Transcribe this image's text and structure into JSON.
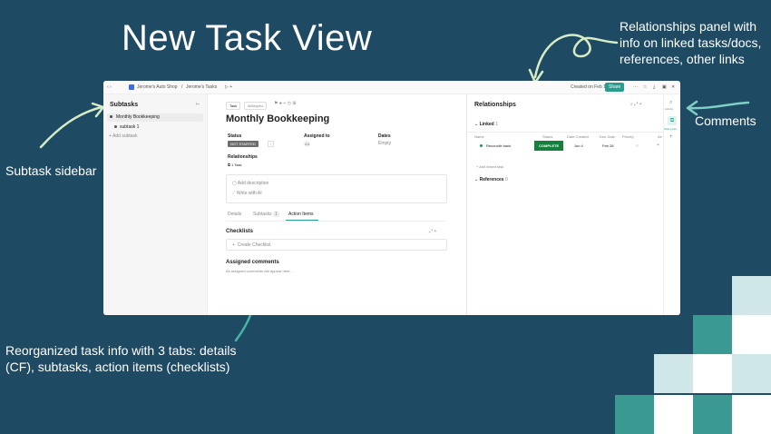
{
  "slide": {
    "title": "New Task View",
    "notes": {
      "relationships": "Relationships panel with info on linked tasks/docs, references, other links",
      "comments": "Comments",
      "subtask_sidebar": "Subtask sidebar",
      "reorganized": "Reorganized task info with 3 tabs: details (CF), subtasks, action items (checklists)"
    },
    "colors": {
      "background": "#1e4a63",
      "accent": "#2a9d8f"
    }
  },
  "topbar": {
    "crumb_workspace": "Jerome's Auto Shop",
    "crumb_list": "Jerome's Tasks",
    "created": "Created on Feb 12",
    "share": "Share"
  },
  "sidebar": {
    "title": "Subtasks",
    "items": [
      {
        "label": "Monthly Bookkeeping"
      },
      {
        "label": "subtask 1"
      }
    ],
    "add": "+ Add subtask"
  },
  "task": {
    "type": "Task",
    "id": "#86eqzhz",
    "title": "Monthly Bookkeeping",
    "status_label": "Status",
    "status_value": "NOT STARTED",
    "assigned_label": "Assigned to",
    "dates_label": "Dates",
    "dates_value": "Empty",
    "relationships_label": "Relationships",
    "relationships_value": "1 Task",
    "add_description": "Add description",
    "write_ai": "Write with AI",
    "tabs": [
      {
        "label": "Details"
      },
      {
        "label": "Subtasks",
        "count": "1"
      },
      {
        "label": "Action Items"
      }
    ],
    "checklists": "Checklists",
    "create_checklist": "Create Checklist",
    "assigned_comments": "Assigned comments",
    "assigned_comments_note": "All assigned comments will appear here..."
  },
  "relationships": {
    "title": "Relationships",
    "linked": "Linked",
    "linked_count": "1",
    "columns": [
      "Name",
      "Status",
      "Date Created",
      "Due Date",
      "Priority",
      "As"
    ],
    "row": {
      "name": "Reconcile bank",
      "status": "COMPLETE",
      "created": "Jun 4",
      "due": "Feb 28"
    },
    "add_linked": "+ Add linked task",
    "references": "References",
    "references_count": "0"
  },
  "activity": {
    "label": "Activity",
    "tasks_label": "Task Links"
  }
}
